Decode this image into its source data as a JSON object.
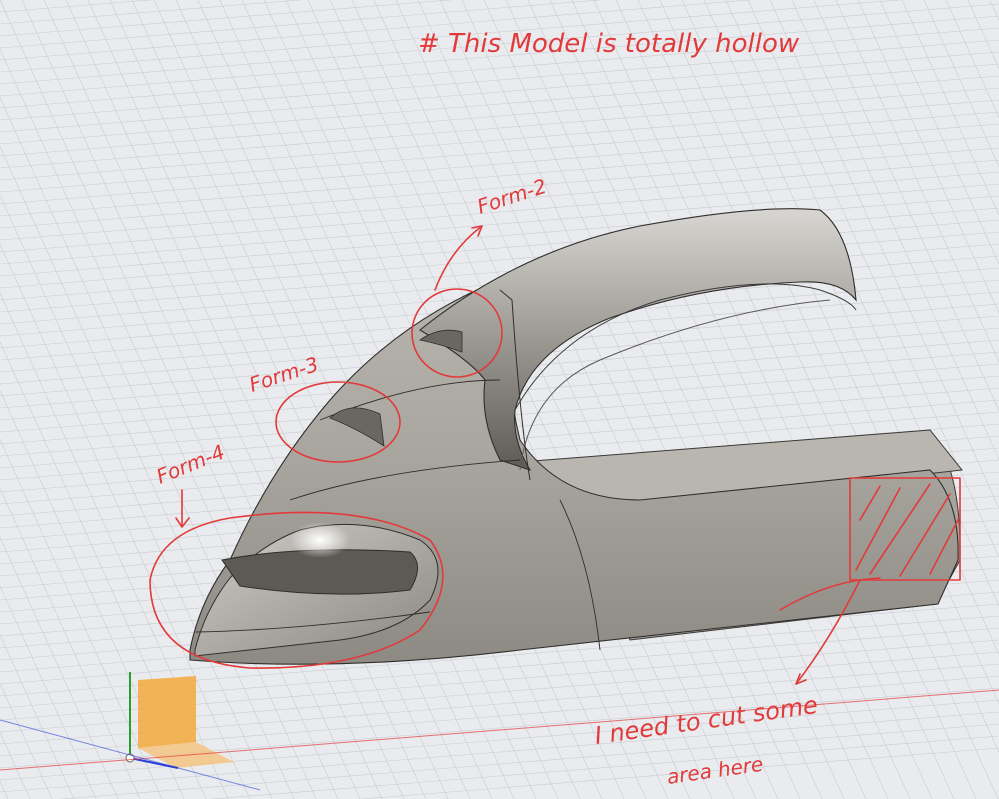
{
  "app": {
    "name": "3D modeling viewport"
  },
  "annotations": {
    "title": "# This Model is totally hollow",
    "form2": "Form-2",
    "form3": "Form-3",
    "form4": "Form-4",
    "note_line1": "I need to cut some",
    "note_line2": "area here"
  },
  "colors": {
    "background": "#e9ebee",
    "grid": "#c9ccd2",
    "model_light": "#d8d6d2",
    "model_mid": "#a9a69f",
    "model_dark": "#6e6b66",
    "annotation_red": "#e23a3a",
    "x_axis": "#e23a3a",
    "y_axis": "#2a9d2a",
    "z_axis": "#2a3fd6",
    "origin_plane": "#f2a93b"
  },
  "icons": {
    "view_cube": "origin-axes-icon"
  }
}
